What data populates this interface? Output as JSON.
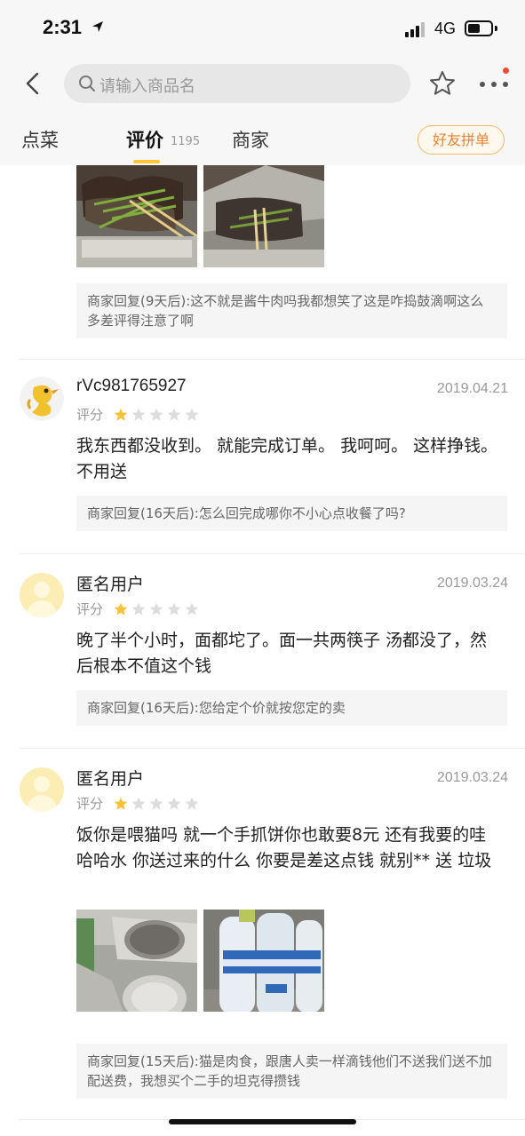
{
  "status_bar": {
    "time": "2:31",
    "network": "4G"
  },
  "nav": {
    "search_placeholder": "请输入商品名"
  },
  "tabs": {
    "dishes": "点菜",
    "reviews": "评价",
    "review_count": "1195",
    "merchant": "商家",
    "group_buy": "好友拼单"
  },
  "rating_label": "评分",
  "top_partial": {
    "reply": "商家回复(9天后):这不就是酱牛肉吗我都想笑了这是咋捣鼓滴啊这么多差评得注意了啊"
  },
  "reviews": [
    {
      "username": "rVc981765927",
      "date": "2019.04.21",
      "stars": 1,
      "text": "我东西都没收到。 就能完成订单。 我呵呵。 这样挣钱。不用送",
      "reply": "商家回复(16天后):怎么回完成哪你不小心点收餐了吗?"
    },
    {
      "username": "匿名用户",
      "date": "2019.03.24",
      "stars": 1,
      "text": "晚了半个小时，面都坨了。面一共两筷子 汤都没了，然后根本不值这个钱",
      "reply": "商家回复(16天后):您给定个价就按您定的卖"
    },
    {
      "username": "匿名用户",
      "date": "2019.03.24",
      "stars": 1,
      "text": "饭你是喂猫吗  就一个手抓饼你也敢要8元   还有我要的哇哈哈水 你送过来的什么  你要是差这点钱  就别** 送    垃圾",
      "reply": "商家回复(15天后):猫是肉食，跟唐人卖一样滴钱他们不送我们送不加配送费，我想买个二手的坦克得攒钱"
    }
  ],
  "colors": {
    "accent": "#ffc734",
    "star_on": "#f8c33a",
    "star_off": "#dddddd",
    "group_buy": "#f0832f"
  }
}
